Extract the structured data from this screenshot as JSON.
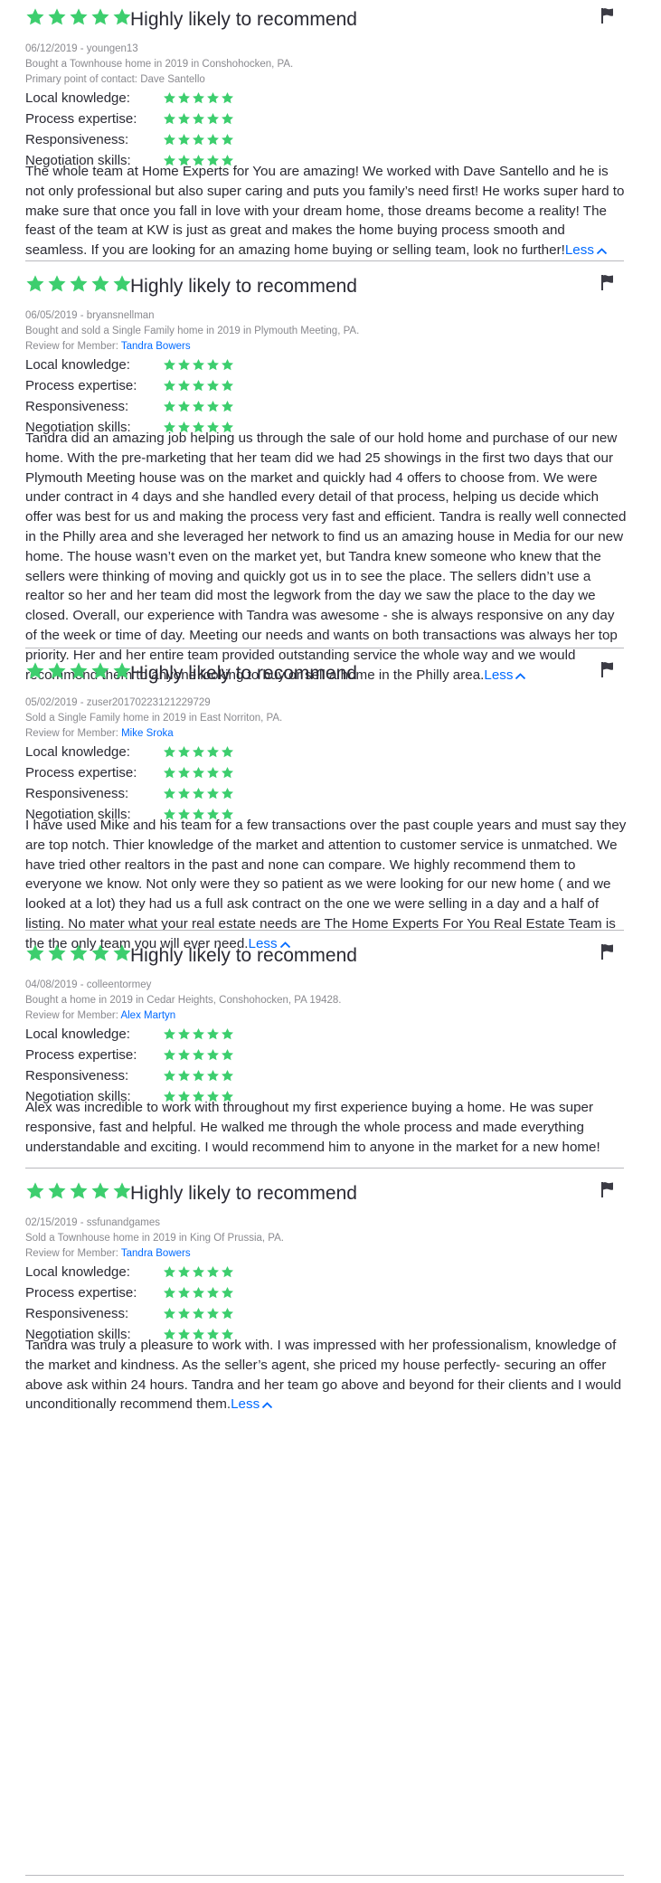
{
  "colors": {
    "star": "#3dce6e",
    "link": "#006aff",
    "text": "#2a2a33",
    "meta": "#8a8a8f",
    "divider": "#b9b9be"
  },
  "icons": {
    "star": "star-icon",
    "flag": "flag-icon",
    "chevron": "chevron-up-icon"
  },
  "rating_labels": [
    "Local knowledge:",
    "Process expertise:",
    "Responsiveness:",
    "Negotiation skills:"
  ],
  "reviews": [
    {
      "stars": 5,
      "headline": "Highly likely to recommend",
      "date_user": "06/12/2019 - youngen13",
      "transaction": "Bought a Townhouse home in 2019 in Conshohocken, PA.",
      "contact_prefix": "Primary point of contact: Dave Santello",
      "contact_name": "",
      "ratings": [
        5,
        5,
        5,
        5
      ],
      "text": "The whole team at Home Experts for You are amazing! We worked with Dave Santello and he is not only professional but also super caring and puts you family’s need first! He works super hard to make sure that once you fall in love with your dream home, those dreams become a reality! The feast of the team at KW is just as great and makes the home buying process smooth and seamless. If you are looking for an amazing home buying or selling team, look no further!",
      "less_label": "Less"
    },
    {
      "stars": 5,
      "headline": "Highly likely to recommend",
      "date_user": "06/05/2019 - bryansnellman",
      "transaction": "Bought and sold a Single Family home in 2019 in Plymouth Meeting, PA.",
      "contact_prefix": "Review for Member: ",
      "contact_name": "Tandra Bowers",
      "ratings": [
        5,
        5,
        5,
        5
      ],
      "text": "Tandra did an amazing job helping us through the sale of our hold home and purchase of our new home. With the pre-marketing that her team did we had 25 showings in the first two days that our Plymouth Meeting house was on the market and quickly had 4 offers to choose from. We were under contract in 4 days and she handled every detail of that process, helping us decide which offer was best for us and making the process very fast and efficient. Tandra is really well connected in the Philly area and she leveraged her network to find us an amazing house in Media for our new home. The house wasn’t even on the market yet, but Tandra knew someone who knew that the sellers were thinking of moving and quickly got us in to see the place.  The sellers didn’t use a realtor so her and her team did most the legwork from the day we saw the place to the day we closed. Overall, our experience with Tandra was awesome - she is always responsive on any day of the week or time of day. Meeting our needs and wants on both transactions was always her top priority. Her and her entire team provided outstanding service the whole way and we would recommend them to anyone looking to buy or sell a home in the Philly area.",
      "less_label": "Less"
    },
    {
      "stars": 5,
      "headline": "Highly likely to recommend",
      "date_user": "05/02/2019 - zuser20170223121229729",
      "transaction": "Sold a Single Family home in 2019 in East Norriton, PA.",
      "contact_prefix": "Review for Member: ",
      "contact_name": "Mike Sroka",
      "ratings": [
        5,
        5,
        5,
        5
      ],
      "text": "I have used Mike and his team for a few transactions over the past couple years and must say they are top notch. Thier knowledge of the market and attention to customer service is unmatched. We have tried other realtors in the past and none can compare. We highly recommend them to everyone we know. Not only were they so patient as we were looking for our new home ( and we looked at a lot) they had us a full ask contract on the one we were selling in a day and a half of listing. No mater what your real estate needs are The Home Experts For You Real Estate Team is the the only team you will ever need.",
      "less_label": "Less"
    },
    {
      "stars": 5,
      "headline": "Highly likely to recommend",
      "date_user": "04/08/2019 - colleentormey",
      "transaction": "Bought a home in 2019 in Cedar Heights, Conshohocken, PA 19428.",
      "contact_prefix": "Review for Member: ",
      "contact_name": "Alex Martyn",
      "ratings": [
        5,
        5,
        5,
        5
      ],
      "text": "Alex was incredible to work with throughout my first experience buying a home. He was super responsive, fast and helpful. He walked me through the whole process and made everything understandable and exciting. I would recommend him to anyone in the market for a new home!",
      "less_label": ""
    },
    {
      "stars": 5,
      "headline": "Highly likely to recommend",
      "date_user": "02/15/2019 - ssfunandgames",
      "transaction": "Sold a Townhouse home in 2019 in King Of Prussia, PA.",
      "contact_prefix": "Review for Member: ",
      "contact_name": "Tandra Bowers",
      "ratings": [
        5,
        5,
        5,
        5
      ],
      "text": "Tandra was truly a pleasure to work with. I was impressed with her professionalism, knowledge of the market and kindness. As the seller’s agent, she priced my house perfectly- securing an offer above ask within 24 hours. Tandra and her team go above and beyond for their clients and I would unconditionally recommend them.",
      "less_label": "Less"
    }
  ]
}
